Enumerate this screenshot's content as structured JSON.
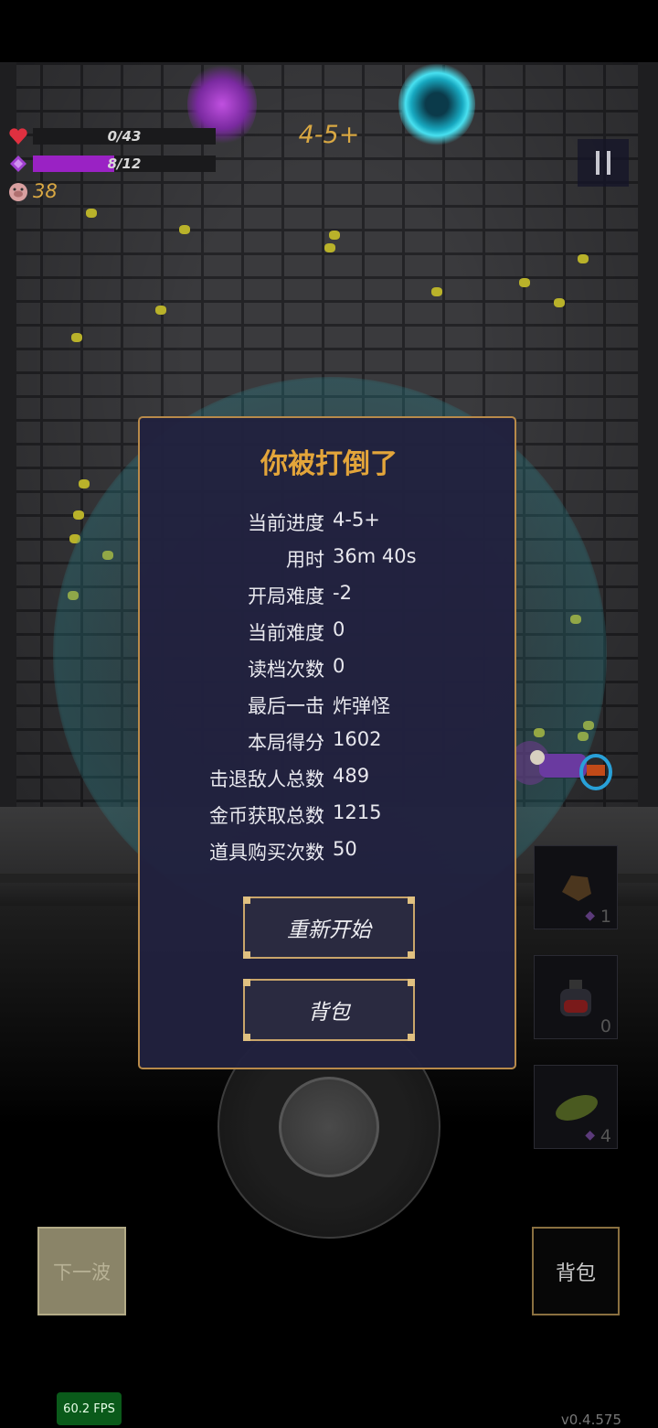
{
  "hud": {
    "health": {
      "current": 0,
      "max": 43,
      "text": "0/43"
    },
    "mana": {
      "current": 8,
      "max": 12,
      "text": "8/12"
    },
    "gold": "38",
    "level": "4-5+",
    "icons": {
      "health": "heart-icon",
      "mana": "diamond-icon",
      "gold": "pig-icon",
      "pause": "pause-icon"
    }
  },
  "dialog": {
    "title": "你被打倒了",
    "stats": [
      {
        "label": "当前进度",
        "value": "4-5+"
      },
      {
        "label": "用时",
        "value": "36m 40s"
      },
      {
        "label": "开局难度",
        "value": "-2"
      },
      {
        "label": "当前难度",
        "value": "0"
      },
      {
        "label": "读档次数",
        "value": "0"
      },
      {
        "label": "最后一击",
        "value": "炸弹怪"
      },
      {
        "label": "本局得分",
        "value": "1602"
      },
      {
        "label": "击退敌人总数",
        "value": "489"
      },
      {
        "label": "金币获取总数",
        "value": "1215"
      },
      {
        "label": "道具购买次数",
        "value": "50"
      }
    ],
    "restart_label": "重新开始",
    "bag_label": "背包"
  },
  "slots": [
    {
      "icon": "rock-icon",
      "count": "1",
      "gem": "◆"
    },
    {
      "icon": "potion-icon",
      "count": "0"
    },
    {
      "icon": "leaf-icon",
      "count": "4",
      "gem": "◆"
    }
  ],
  "controls": {
    "next_wave": "下一波",
    "bag": "背包"
  },
  "fps": "60.2 FPS",
  "version": "v0.4.575",
  "colors": {
    "accent": "#d9a843",
    "mana": "#9a22c4",
    "dialog_bg": "#21213e",
    "border": "#b88a4a"
  }
}
